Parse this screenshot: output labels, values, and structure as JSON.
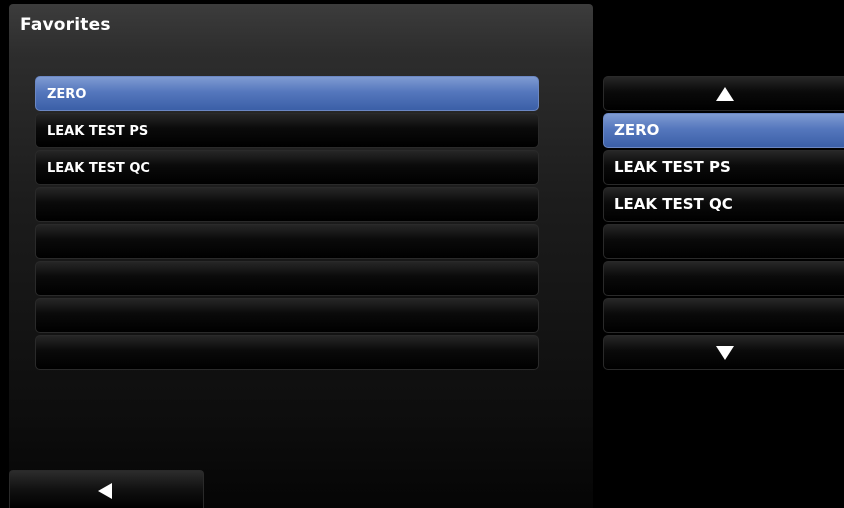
{
  "header": {
    "title": "Favorites"
  },
  "left_list": {
    "items": [
      "ZERO",
      "LEAK TEST PS",
      "LEAK TEST QC",
      "",
      "",
      "",
      "",
      ""
    ],
    "selected_index": 0
  },
  "right_list": {
    "items": [
      "ZERO",
      "LEAK TEST PS",
      "LEAK TEST QC",
      "",
      "",
      ""
    ],
    "selected_index": 0,
    "scroll_up_icon": "triangle-up-icon",
    "scroll_down_icon": "triangle-down-icon"
  },
  "footer": {
    "back_icon": "triangle-left-icon"
  },
  "colors": {
    "selected": "#5577bd",
    "background": "#000000"
  }
}
